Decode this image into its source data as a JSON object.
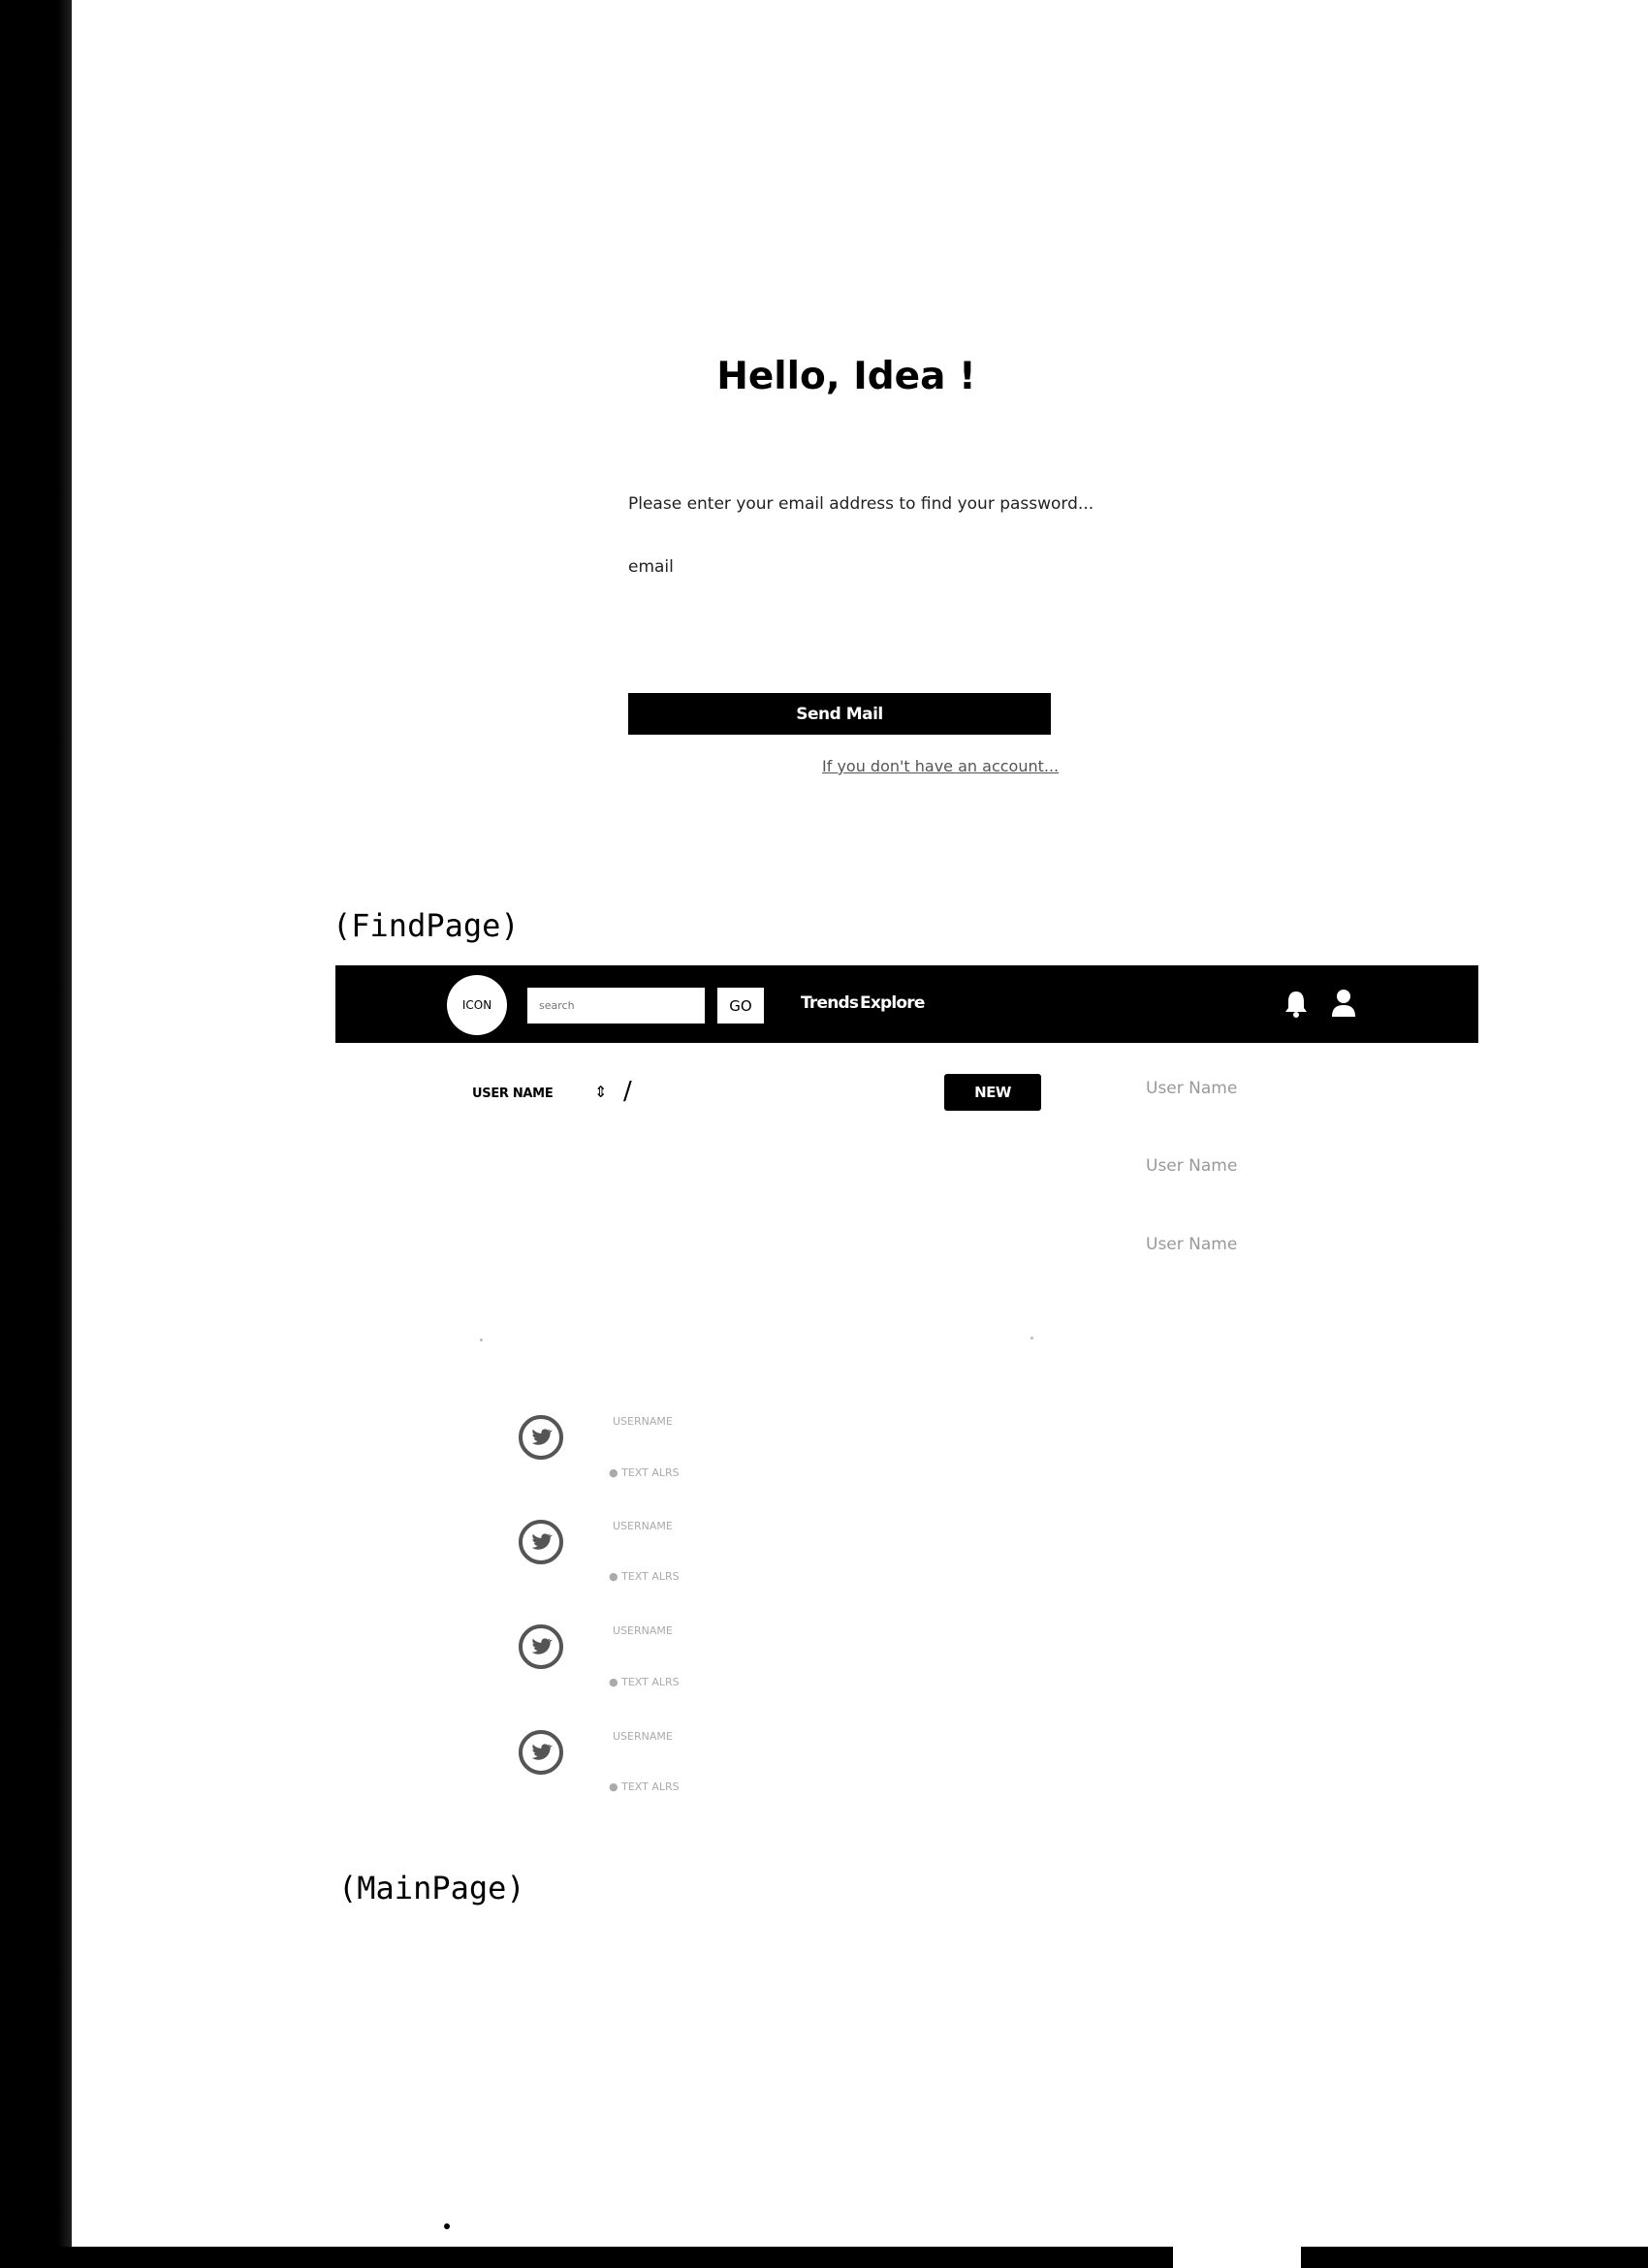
{
  "find_page": {
    "title": "Hello, Idea !",
    "subtitle": "Please enter your email address to find your password...",
    "email_label": "email",
    "send_button": "Send Mail",
    "signup_link": "If you don't have an account..."
  },
  "captions": {
    "find": "(FindPage)",
    "main": "(MainPage)"
  },
  "main_page": {
    "navbar": {
      "logo_label": "ICON",
      "search_placeholder": "search",
      "go_label": "GO",
      "links": [
        "Trends",
        "Explore"
      ],
      "icons": [
        "bell-icon",
        "user-icon"
      ]
    },
    "composer": {
      "username_label": "USER NAME",
      "separator": "/",
      "new_button": "NEW"
    },
    "suggestions": [
      "User Name",
      "User Name",
      "User Name"
    ],
    "feed": [
      {
        "name": "USERNAME",
        "meta": "● TEXT ALRS"
      },
      {
        "name": "USERNAME",
        "meta": "● TEXT ALRS"
      },
      {
        "name": "USERNAME",
        "meta": "● TEXT ALRS"
      },
      {
        "name": "USERNAME",
        "meta": "● TEXT ALRS"
      }
    ]
  }
}
